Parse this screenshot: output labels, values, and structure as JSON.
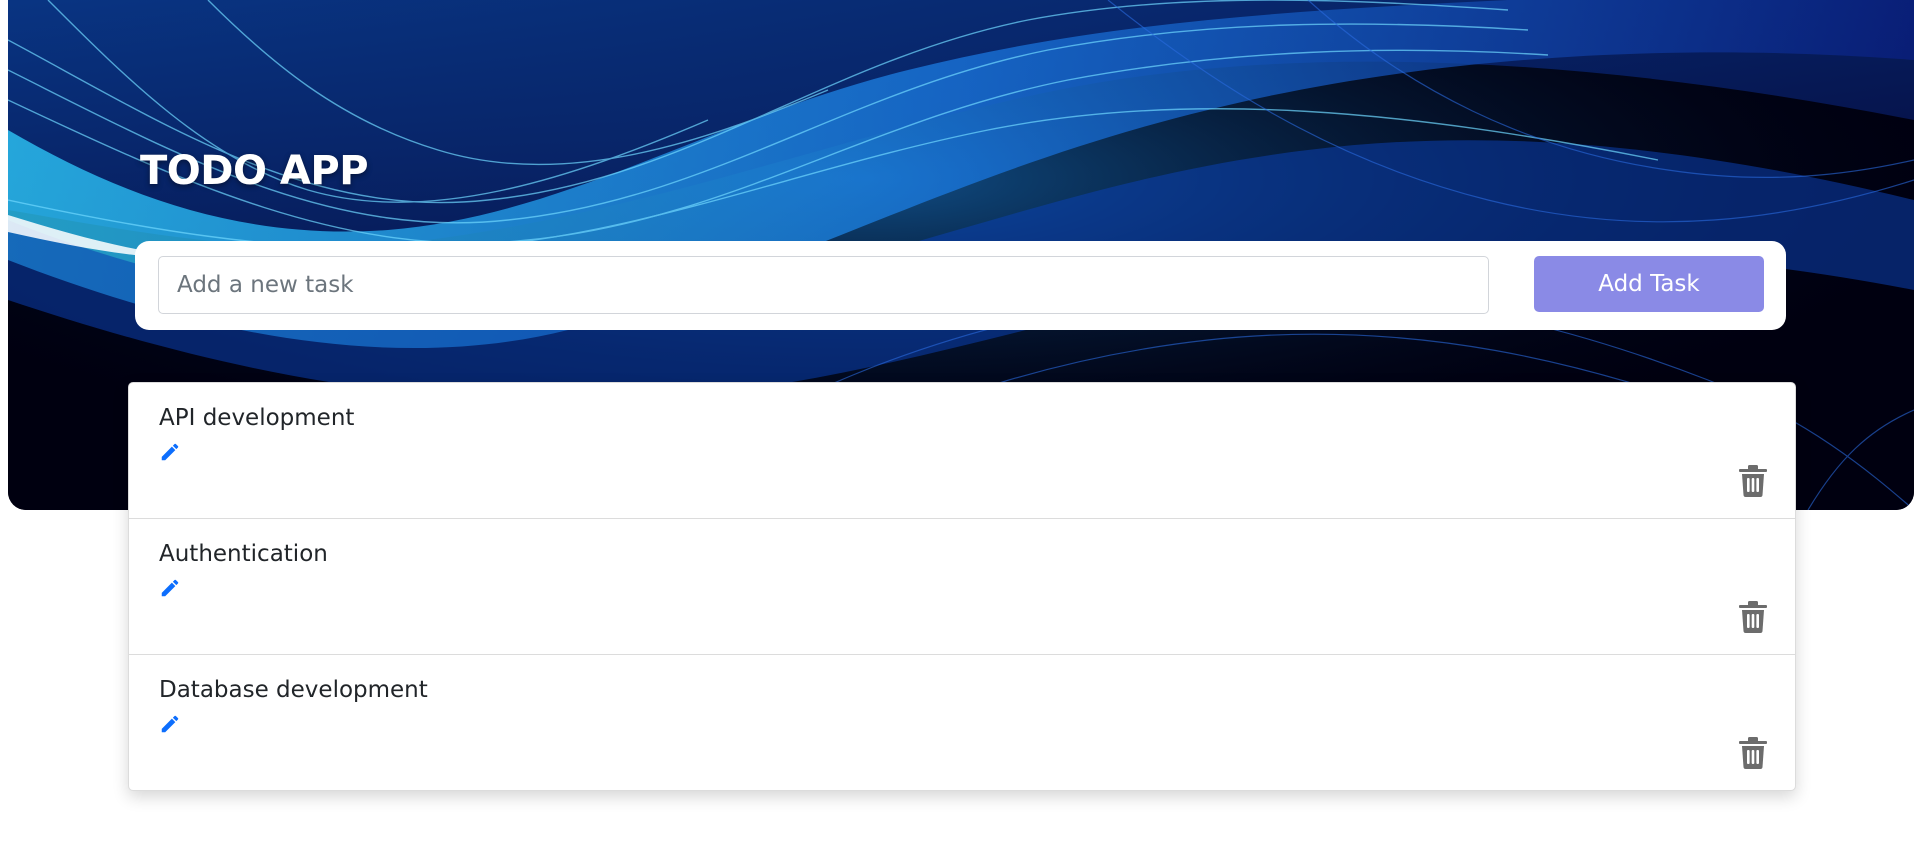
{
  "app": {
    "title": "TODO APP"
  },
  "new_task": {
    "placeholder": "Add a new task",
    "value": "",
    "button_label": "Add Task"
  },
  "tasks": [
    {
      "text": "API development"
    },
    {
      "text": "Authentication"
    },
    {
      "text": "Database development"
    }
  ],
  "icons": {
    "edit": "pencil-icon",
    "delete": "trash-icon"
  },
  "colors": {
    "accent": "#8a8ae6",
    "edit_icon": "#0d6efd",
    "delete_icon": "#6c6c6c",
    "hero_dark": "#000010",
    "hero_light": "#2fb8f0"
  }
}
